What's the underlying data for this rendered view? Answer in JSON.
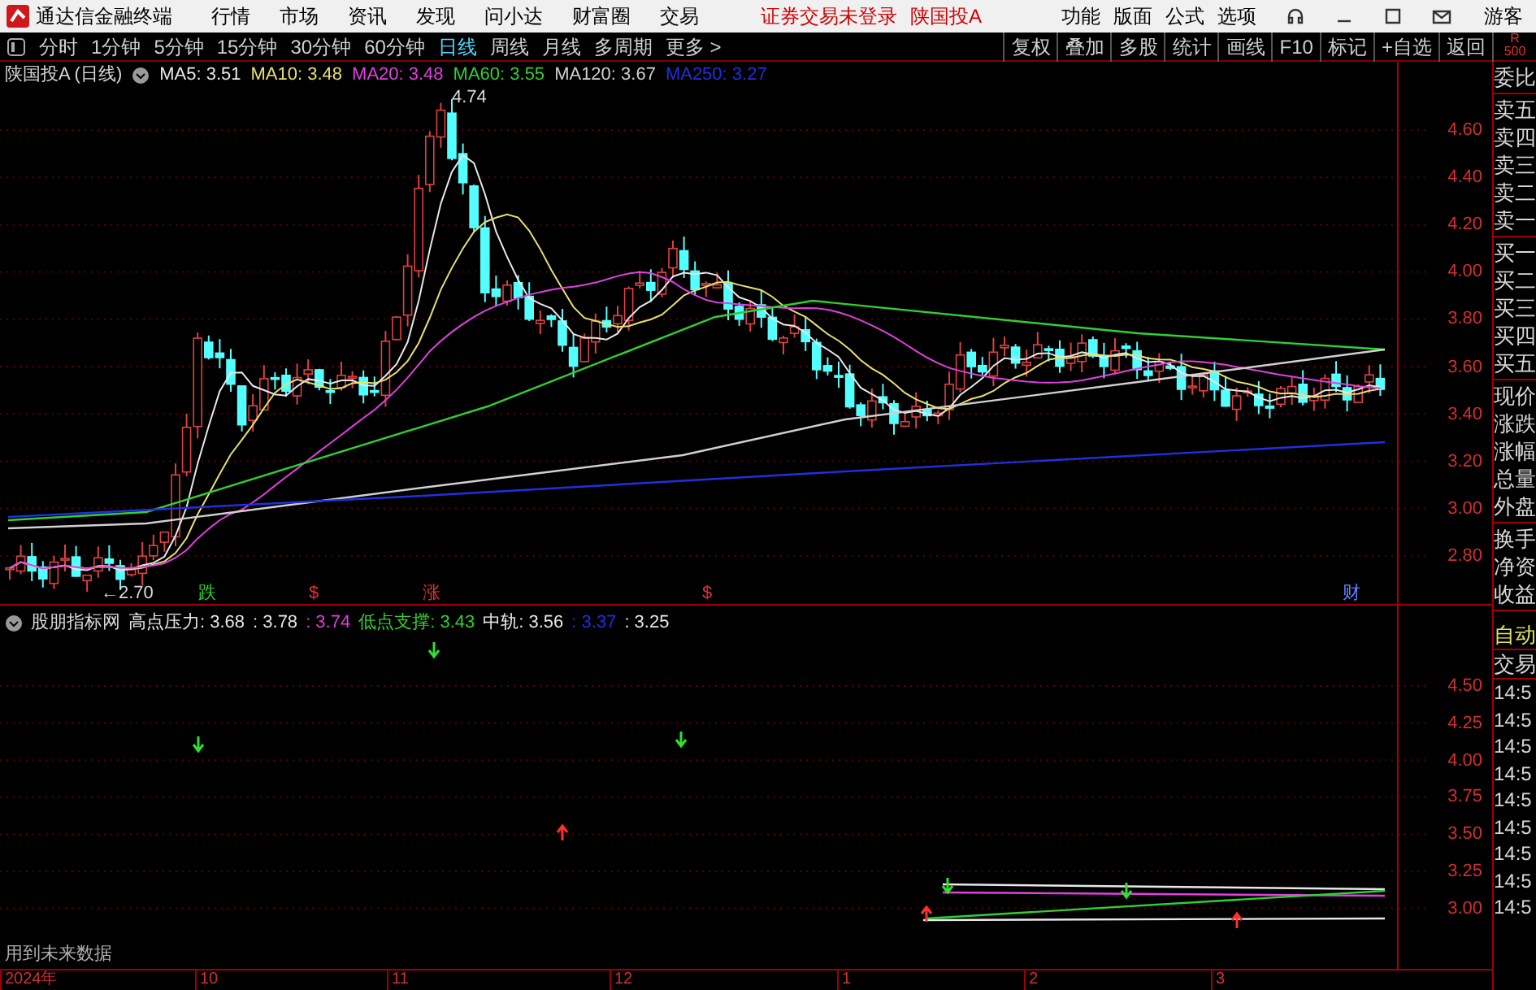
{
  "app": {
    "title": "通达信金融终端",
    "menu": [
      "行情",
      "市场",
      "资讯",
      "发现",
      "问小达",
      "财富圈",
      "交易"
    ],
    "notice": "证券交易未登录",
    "stock": "陕国投A",
    "right_menu": [
      "功能",
      "版面",
      "公式",
      "选项"
    ],
    "user": "游客"
  },
  "toolbar": {
    "periods": [
      {
        "label": "分时",
        "selected": false
      },
      {
        "label": "1分钟",
        "selected": false
      },
      {
        "label": "5分钟",
        "selected": false
      },
      {
        "label": "15分钟",
        "selected": false
      },
      {
        "label": "30分钟",
        "selected": false
      },
      {
        "label": "60分钟",
        "selected": false
      },
      {
        "label": "日线",
        "selected": true
      },
      {
        "label": "周线",
        "selected": false
      },
      {
        "label": "月线",
        "selected": false
      },
      {
        "label": "多周期",
        "selected": false
      },
      {
        "label": "更多 >",
        "selected": false
      }
    ],
    "buttons": [
      "复权",
      "叠加",
      "多股",
      "统计",
      "画线",
      "F10",
      "标记",
      "+自选",
      "返回"
    ],
    "corner": [
      "R",
      "500"
    ]
  },
  "main_chart": {
    "title": "陕国投A (日线)",
    "legend": [
      {
        "text": "MA5: 3.51",
        "color": "#e8e8e8"
      },
      {
        "text": "MA10: 3.48",
        "color": "#e8e070"
      },
      {
        "text": "MA20: 3.48",
        "color": "#e040e0"
      },
      {
        "text": "MA60: 3.55",
        "color": "#30d030"
      },
      {
        "text": "MA120: 3.67",
        "color": "#d0d0d0"
      },
      {
        "text": "MA250: 3.27",
        "color": "#2030e0"
      }
    ],
    "yticks": [
      "4.60",
      "4.40",
      "4.20",
      "4.00",
      "3.80",
      "3.60",
      "3.40",
      "3.20",
      "3.00",
      "2.80"
    ],
    "high_label": "4.74",
    "low_label": "←2.70",
    "markers": [
      {
        "text": "跌",
        "color": "#30d030"
      },
      {
        "text": "$",
        "color": "#e03030"
      },
      {
        "text": "涨",
        "color": "#e03030"
      },
      {
        "text": "$",
        "color": "#e03030"
      },
      {
        "text": "财",
        "color": "#6080ff"
      }
    ]
  },
  "indicator": {
    "name": "股朋指标网",
    "legend": [
      {
        "text": "高点压力: 3.68",
        "color": "#e8e8e8"
      },
      {
        "text": ": 3.78",
        "color": "#e8e8e8"
      },
      {
        "text": ": 3.74",
        "color": "#e040e0"
      },
      {
        "text": "低点支撑: 3.43",
        "color": "#30d030"
      },
      {
        "text": "中轨: 3.56",
        "color": "#e8e8e8"
      },
      {
        "text": ": 3.37",
        "color": "#2030e0"
      },
      {
        "text": ": 3.25",
        "color": "#e8e8e8"
      }
    ],
    "yticks": [
      "4.50",
      "4.25",
      "4.00",
      "3.75",
      "3.50",
      "3.25",
      "3.00"
    ],
    "note": "用到未来数据"
  },
  "time_axis": [
    "2024年",
    "10",
    "11",
    "12",
    "1",
    "2",
    "3"
  ],
  "quote_panel": {
    "groups": [
      [
        "委比"
      ],
      [
        "卖五",
        "卖四",
        "卖三",
        "卖二",
        "卖一"
      ],
      [
        "买一",
        "买二",
        "买三",
        "买四",
        "买五"
      ],
      [
        "现价",
        "涨跌",
        "涨幅",
        "总量",
        "外盘"
      ],
      [
        "换手",
        "净资",
        "收益"
      ]
    ],
    "auto": "自动",
    "trade_header": "交易",
    "trades": [
      "14:5",
      "14:5",
      "14:5",
      "14:5",
      "14:5",
      "14:5",
      "14:5",
      "14:5",
      "14:5"
    ]
  }
}
